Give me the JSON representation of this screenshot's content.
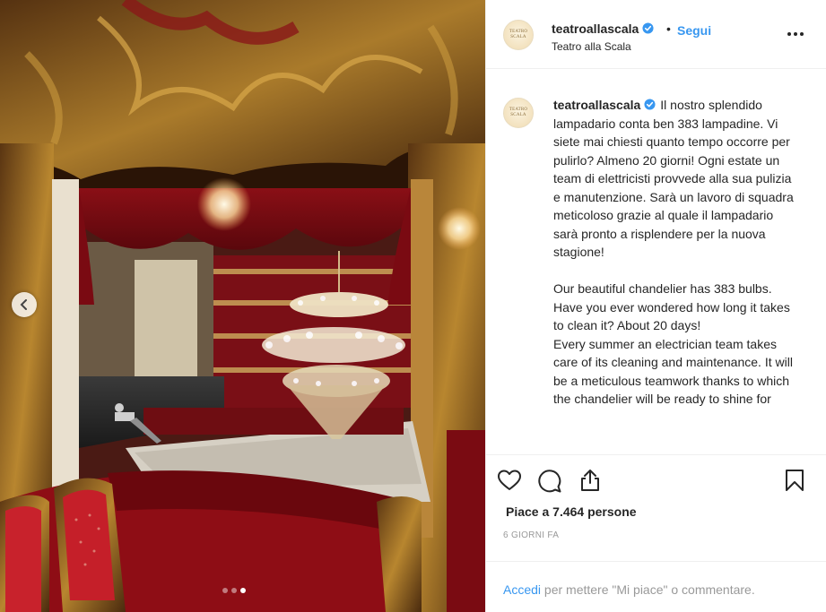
{
  "post": {
    "username": "teatroallascala",
    "follow_label": "Segui",
    "separator": "•",
    "location": "Teatro alla Scala",
    "avatar_text": "TEATRO\nSCALA",
    "caption": "Il nostro splendido lampadario conta ben 383 lampadine. Vi siete mai chiesti quanto tempo occorre per pulirlo? Almeno 20 giorni! Ogni estate un team di elettricisti provvede alla sua pulizia e manutenzione. Sarà un lavoro di squadra meticoloso grazie al quale il lampadario sarà pronto a risplendere per la nuova stagione!\n\nOur beautiful chandelier has 383 bulbs. Have you ever wondered how long it takes to clean it? About 20 days!\nEvery summer an electrician team takes care of its cleaning and maintenance. It will be a meticulous teamwork thanks to which the chandelier will be ready to shine for",
    "likes": "Piace a 7.464 persone",
    "timestamp": "6 GIORNI FA",
    "login_link": "Accedi",
    "login_text": " per mettere \"Mi piace\" o commentare.",
    "carousel": {
      "slides": 3,
      "active": 3
    }
  },
  "colors": {
    "link": "#3897f0",
    "text": "#262626",
    "muted": "#999999",
    "verified": "#3897f0",
    "border": "#efefef"
  },
  "icons": [
    "chevron-left-icon",
    "verified-badge-icon",
    "more-options-icon",
    "heart-icon",
    "comment-icon",
    "share-icon",
    "bookmark-icon"
  ]
}
